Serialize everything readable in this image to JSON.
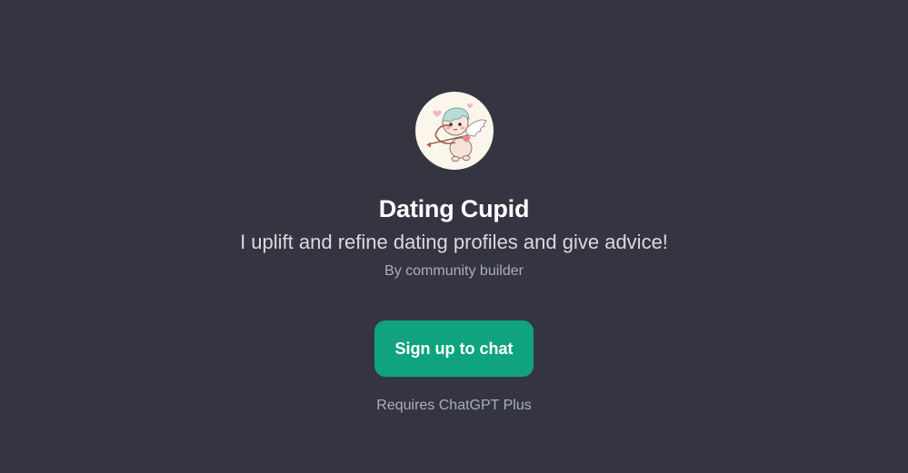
{
  "gpt": {
    "avatar_icon": "cupid-icon",
    "name": "Dating Cupid",
    "description": "I uplift and refine dating profiles and give advice!",
    "byline": "By community builder"
  },
  "actions": {
    "signup_label": "Sign up to chat",
    "requirement_note": "Requires ChatGPT Plus"
  },
  "colors": {
    "background": "#343541",
    "accent": "#10a37f"
  }
}
